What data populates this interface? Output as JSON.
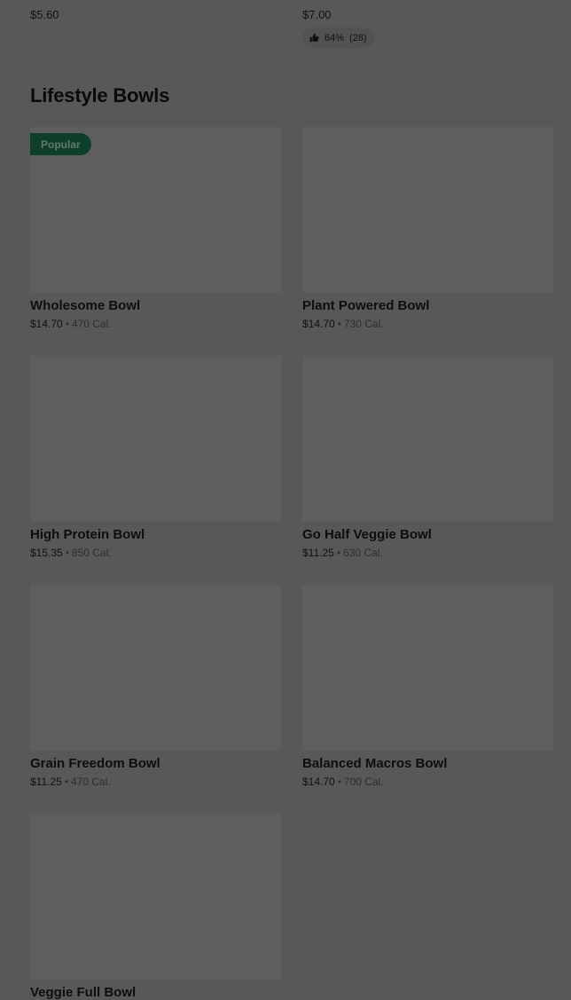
{
  "previous_row": [
    {
      "title": "",
      "price": "$5.60"
    },
    {
      "title": "",
      "price": "$7.00",
      "rating": {
        "percent": "64%",
        "count": "(28)"
      }
    }
  ],
  "section": {
    "title": "Lifestyle Bowls"
  },
  "cards": [
    {
      "name": "Wholesome Bowl",
      "price": "$14.70",
      "separator": "•",
      "calories": "470 Cal.",
      "badge": "Popular"
    },
    {
      "name": "Plant Powered Bowl",
      "price": "$14.70",
      "separator": "•",
      "calories": "730 Cal."
    },
    {
      "name": "High Protein Bowl",
      "price": "$15.35",
      "separator": "•",
      "calories": "850 Cal."
    },
    {
      "name": "Go Half Veggie Bowl",
      "price": "$11.25",
      "separator": "•",
      "calories": "630 Cal."
    },
    {
      "name": "Grain Freedom Bowl",
      "price": "$11.25",
      "separator": "•",
      "calories": "470 Cal."
    },
    {
      "name": "Balanced Macros Bowl",
      "price": "$14.70",
      "separator": "•",
      "calories": "700 Cal."
    },
    {
      "name": "Veggie Full Bowl",
      "price": "",
      "separator": "",
      "calories": ""
    }
  ],
  "icons": {
    "rating": "thumbs-up-icon"
  },
  "colors": {
    "overlay": "#585858",
    "image_placeholder": "#5e5e5e",
    "badge_bg": "#0f3f2b",
    "badge_text": "#5f7b6d"
  }
}
